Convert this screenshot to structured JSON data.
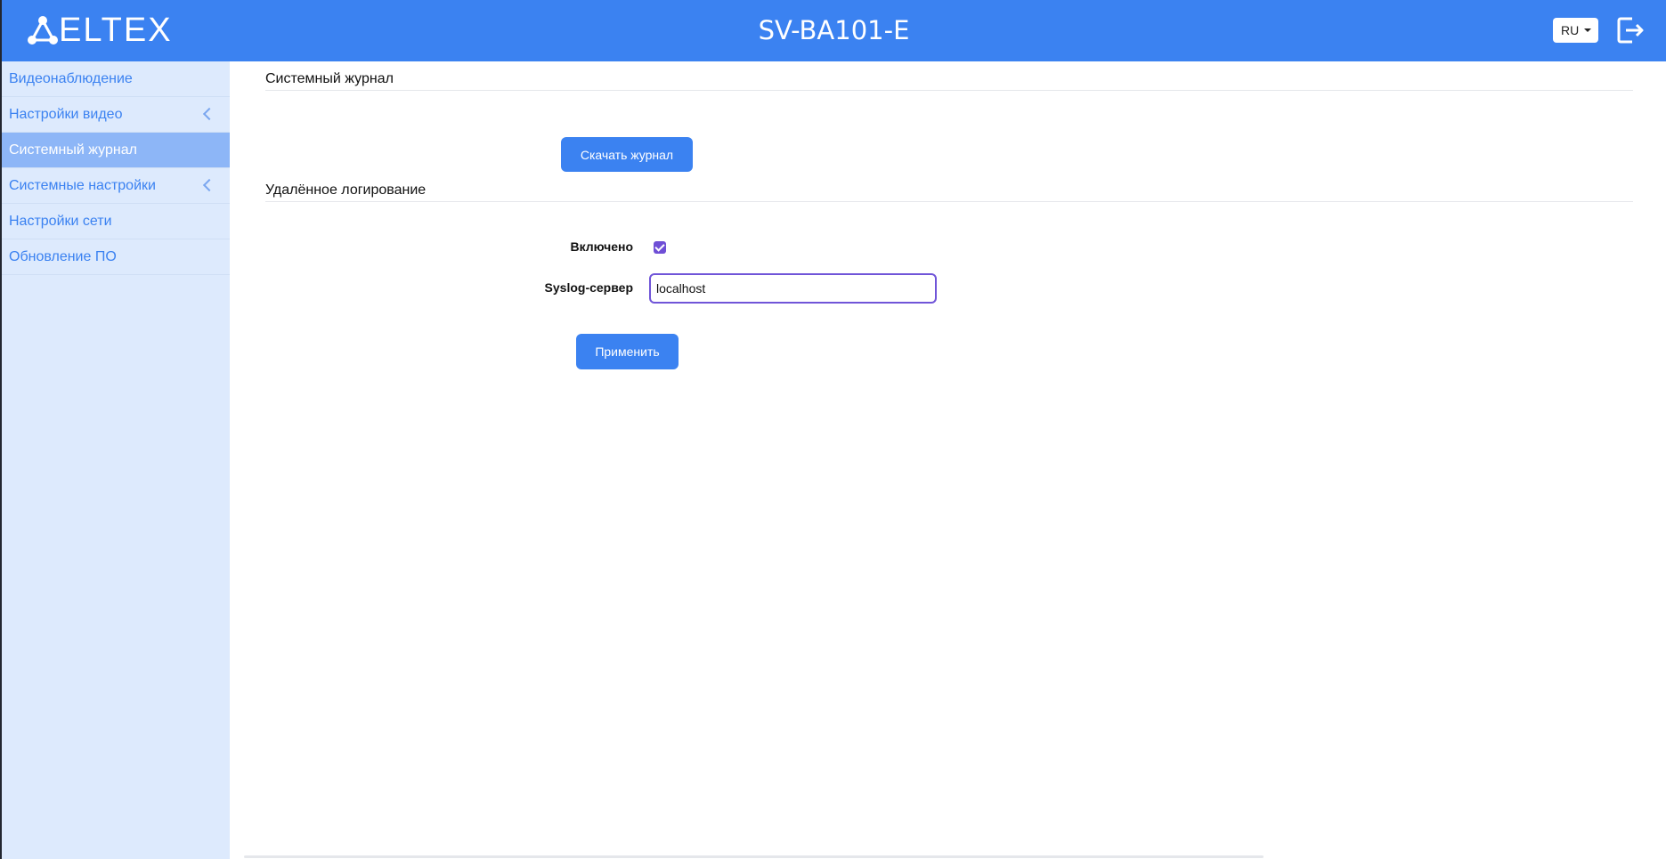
{
  "header": {
    "logo_text": "ELTEX",
    "title": "SV-BA101-E",
    "language": "RU",
    "logout_icon": "logout-icon"
  },
  "sidebar": {
    "items": [
      {
        "label": "Видеонаблюдение",
        "expandable": false,
        "active": false
      },
      {
        "label": "Настройки видео",
        "expandable": true,
        "active": false
      },
      {
        "label": "Системный журнал",
        "expandable": false,
        "active": true
      },
      {
        "label": "Системные настройки",
        "expandable": true,
        "active": false
      },
      {
        "label": "Настройки сети",
        "expandable": false,
        "active": false
      },
      {
        "label": "Обновление ПО",
        "expandable": false,
        "active": false
      }
    ]
  },
  "main": {
    "syslog_section": {
      "title": "Системный журнал",
      "download_button": "Скачать журнал"
    },
    "remote_section": {
      "title": "Удалённое логирование",
      "enabled_label": "Включено",
      "enabled_checked": true,
      "server_label": "Syslog-сервер",
      "server_value": "localhost",
      "apply_button": "Применить"
    }
  },
  "colors": {
    "brand_blue": "#3b82f1",
    "sidebar_bg": "#ddeafd",
    "sidebar_active": "#8db6f7",
    "checkbox_accent": "#6f4fd6"
  }
}
